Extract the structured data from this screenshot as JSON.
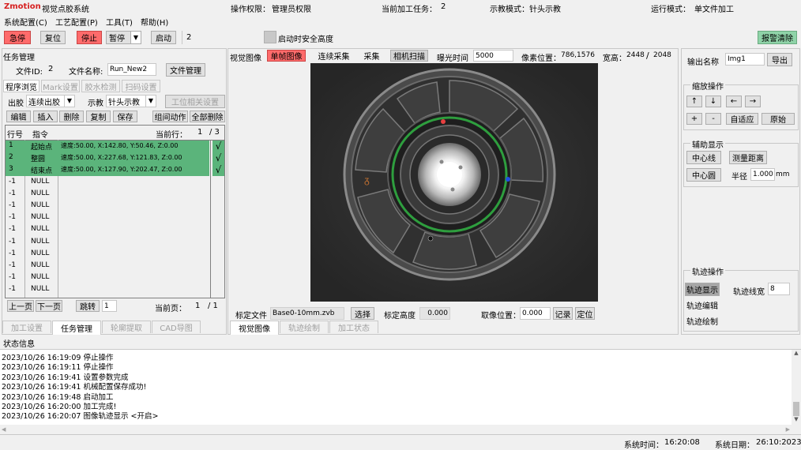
{
  "header": {
    "logo": "Zmotion",
    "app_title": "视觉点胶系统",
    "permission_label": "操作权限：",
    "permission_value": "管理员权限",
    "task_label": "当前加工任务：",
    "task_value": "2",
    "teach_label": "示教模式：",
    "teach_value": "针头示教",
    "run_label": "运行模式：",
    "run_value": "单文件加工"
  },
  "menu": [
    "系统配置(C)",
    "工艺配置(P)",
    "工具(T)",
    "帮助(H)"
  ],
  "toolbar": {
    "estop": "急停",
    "reset": "复位",
    "stop": "停止",
    "pause": "暂停",
    "start": "启动",
    "start_count": "2",
    "safe_height": "启动时安全高度",
    "alarm_clear": "报警清除"
  },
  "task": {
    "title": "任务管理",
    "file_id_label": "文件ID:",
    "file_id": "2",
    "file_name_label": "文件名称:",
    "file_name": "Run_New2",
    "file_mgmt": "文件管理",
    "subtabs": [
      "程序浏览",
      "Mark设置",
      "胶水检测",
      "扫码设置"
    ],
    "dispense_label": "出胶",
    "dispense_value": "连续出胶",
    "teach_label": "示教",
    "teach_value": "针头示教",
    "station_btn": "工位相关设置",
    "edit_btns": [
      "编辑",
      "插入",
      "删除",
      "复制",
      "保存",
      "组间动作",
      "全部删除"
    ],
    "col_line": "行号",
    "col_cmd": "指令",
    "cur_line_label": "当前行：",
    "cur_line": "1",
    "cur_total": "/ 3",
    "rows": [
      {
        "no": "1",
        "cmd": "起始点",
        "param": "速度:50.00, X:142.80, Y:50.46, Z:0.00",
        "check": "√"
      },
      {
        "no": "2",
        "cmd": "整圆",
        "param": "速度:50.00, X:227.68, Y:121.83, Z:0.00",
        "check": "√"
      },
      {
        "no": "3",
        "cmd": "结束点",
        "param": "速度:50.00, X:127.90, Y:202.47, Z:0.00",
        "check": "√"
      },
      {
        "no": "-1",
        "cmd": "NULL"
      },
      {
        "no": "-1",
        "cmd": "NULL"
      },
      {
        "no": "-1",
        "cmd": "NULL"
      },
      {
        "no": "-1",
        "cmd": "NULL"
      },
      {
        "no": "-1",
        "cmd": "NULL"
      },
      {
        "no": "-1",
        "cmd": "NULL"
      },
      {
        "no": "-1",
        "cmd": "NULL"
      },
      {
        "no": "-1",
        "cmd": "NULL"
      },
      {
        "no": "-1",
        "cmd": "NULL"
      },
      {
        "no": "-1",
        "cmd": "NULL"
      }
    ],
    "prev": "上一页",
    "next": "下一页",
    "jump": "跳转",
    "jump_value": "1",
    "page_label": "当前页：",
    "page_cur": "1",
    "page_total": "/ 1",
    "bottom_tabs": [
      "加工设置",
      "任务管理",
      "轮廓提取",
      "CAD导图"
    ]
  },
  "vision": {
    "title": "视觉图像",
    "single": "单帧图像",
    "continuous": "连续采集",
    "capture": "采集",
    "camera_scan": "相机扫描",
    "exposure_label": "曝光时间",
    "exposure": "5000",
    "pixel_label": "像素位置：",
    "pixel_value": "786,1576",
    "wh_label": "宽高：",
    "width": "2448",
    "height_sep": "/",
    "height": "2048",
    "calib_label": "标定文件",
    "calib_file": "Base0-10mm.zvb",
    "select": "选择",
    "calib_h_label": "标定高度",
    "calib_h": "0.000",
    "capture_pos_label": "取像位置：",
    "capture_pos": "0.000",
    "record": "记录",
    "locate": "定位",
    "bottom_tabs": [
      "视觉图像",
      "轨迹绘制",
      "加工状态"
    ]
  },
  "right": {
    "output_label": "输出名称",
    "output_value": "Img1",
    "export": "导出",
    "zoom_title": "缩放操作",
    "zoom_btns": [
      "↑",
      "↓",
      "←",
      "→",
      "+",
      "-"
    ],
    "fit": "自适应",
    "original": "原始",
    "aux_title": "辅助显示",
    "center_line": "中心线",
    "measure": "测量距离",
    "center_circle": "中心圆",
    "radius_label": "半径",
    "radius": "1.000",
    "radius_unit": "mm",
    "track_title": "轨迹操作",
    "track_show": "轨迹显示",
    "track_width_label": "轨迹线宽",
    "track_width": "8",
    "track_edit": "轨迹编辑",
    "track_draw": "轨迹绘制"
  },
  "status": {
    "title": "状态信息",
    "logs": [
      "2023/10/26 16:19:09  停止操作",
      "2023/10/26 16:19:11  停止操作",
      "2023/10/26 16:19:41  设置参数完成",
      "2023/10/26 16:19:41  机械配置保存成功!",
      "2023/10/26 16:19:48  启动加工",
      "2023/10/26 16:20:00  加工完成!",
      "2023/10/26 16:20:07  图像轨迹显示 <开启>"
    ],
    "sys_time_label": "系统时间：",
    "sys_time": "16:20:08",
    "sys_date_label": "系统日期：",
    "sys_date": "26:10:2023"
  },
  "colors": {
    "red": "#ff6b6b",
    "green": "#5bb47b",
    "track": "#2e9e3e"
  }
}
